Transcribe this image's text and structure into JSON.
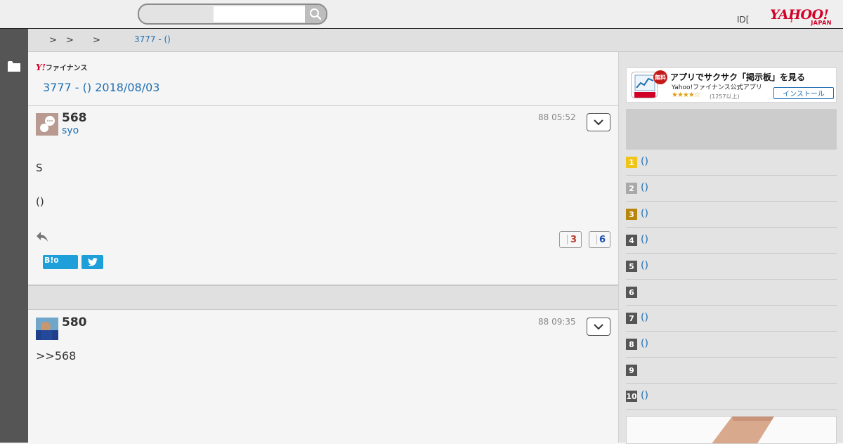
{
  "header": {
    "search_placeholder": "",
    "login_text": "ID[",
    "login_caret": "]",
    "logo_main": "YAHOO!",
    "logo_sub": "JAPAN"
  },
  "breadcrumb": {
    "separators": [
      ">",
      ">",
      ">"
    ],
    "current": "3777 - ()"
  },
  "main": {
    "finance_logo_y": "Y!",
    "finance_logo_text": "ファイナンス",
    "thread_title": "3777 - () 2018/08/03"
  },
  "posts": [
    {
      "number": "568",
      "user": "syo",
      "time": "88 05:52",
      "body_line1": "S",
      "body_line2": "()",
      "votes_yes": "3",
      "votes_no": "6",
      "hatena_label": "B!",
      "hatena_count": "0"
    },
    {
      "number": "580",
      "time": "88 09:35",
      "body_line1": ">>568"
    }
  ],
  "sidebar": {
    "app_banner": {
      "badge": "無料",
      "title": "アプリでサクサク「掲示板」を見る",
      "subtitle": "Yahoo!ファイナンス公式アプリ",
      "stars": "★★★★☆",
      "rating_count": "(1257以上)",
      "install_label": "インストール",
      "rating": 4
    },
    "ranking": [
      {
        "rank": "1",
        "label": "()",
        "color": "#f0c419"
      },
      {
        "rank": "2",
        "label": "()",
        "color": "#a9a9a9"
      },
      {
        "rank": "3",
        "label": "()",
        "color": "#b8860b"
      },
      {
        "rank": "4",
        "label": "()",
        "color": "#555555"
      },
      {
        "rank": "5",
        "label": "()",
        "color": "#555555"
      },
      {
        "rank": "6",
        "label": "",
        "color": "#555555"
      },
      {
        "rank": "7",
        "label": "()",
        "color": "#555555"
      },
      {
        "rank": "8",
        "label": "()",
        "color": "#555555"
      },
      {
        "rank": "9",
        "label": "",
        "color": "#555555"
      },
      {
        "rank": "10",
        "label": "()",
        "color": "#555555"
      }
    ]
  },
  "colors": {
    "link": "#1f6fb2",
    "brand_red": "#d10028",
    "social_blue": "#1e9fd9"
  }
}
